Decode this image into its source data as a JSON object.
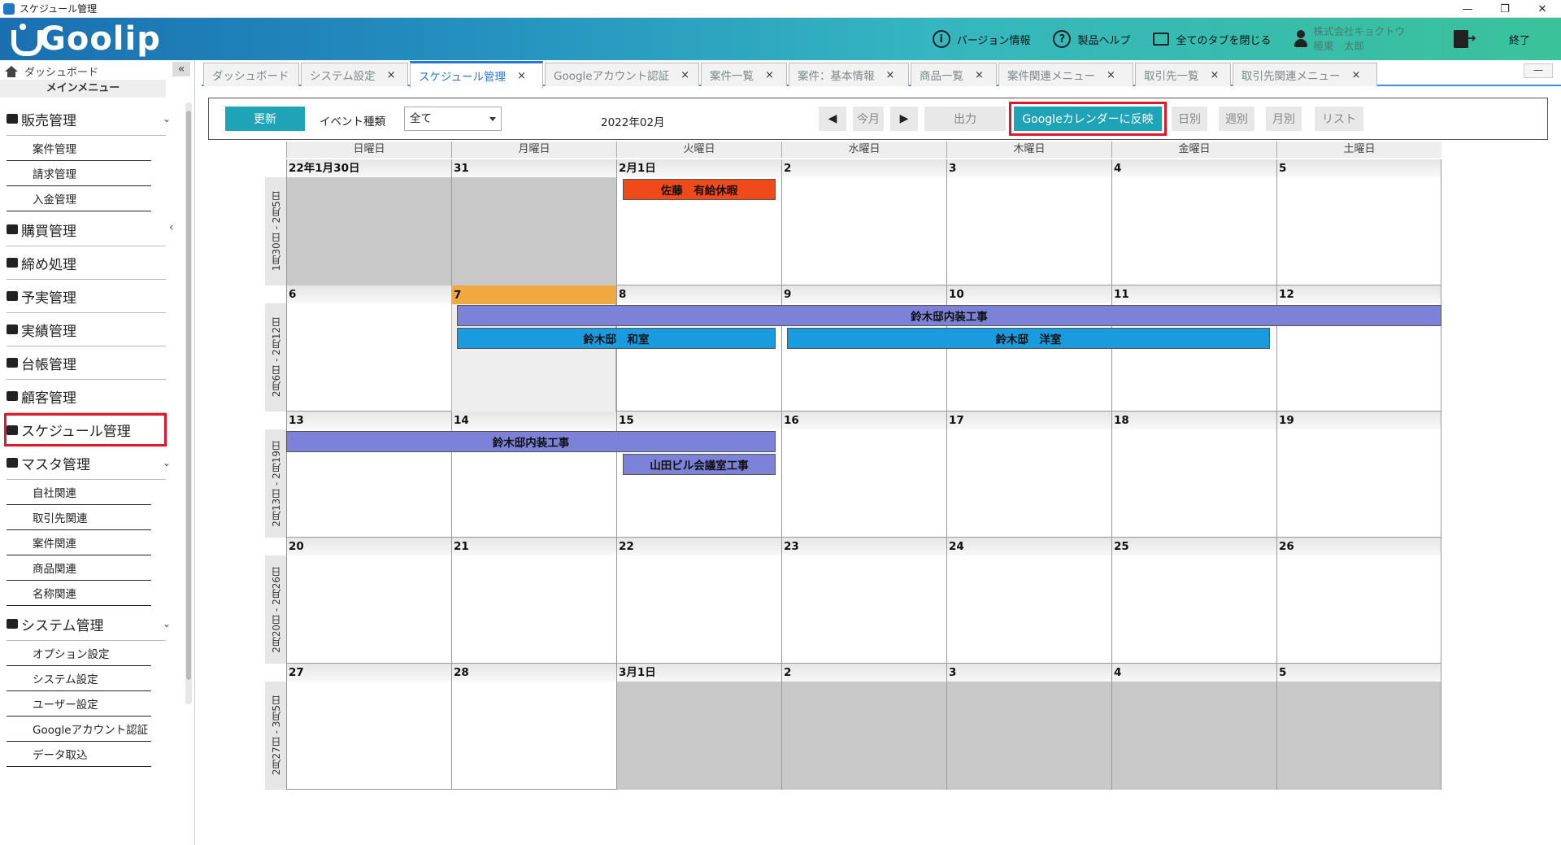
{
  "window": {
    "title": "スケジュール管理",
    "minimize": "—",
    "maximize": "❐",
    "close": "✕"
  },
  "header": {
    "logo": "Goolip",
    "version": "バージョン情報",
    "help": "製品ヘルプ",
    "close_tabs": "全てのタブを閉じる",
    "company": "株式会社キョクトウ",
    "user": "極東　太郎",
    "exit": "終了"
  },
  "sidebar": {
    "dashboard": "ダッシュボード",
    "collapse": "«",
    "main_menu": "メインメニュー",
    "side_chevron": "‹",
    "sales": {
      "label": "販売管理",
      "chev": "⌄",
      "items": [
        "案件管理",
        "請求管理",
        "入金管理"
      ]
    },
    "purchase": "購買管理",
    "closing": "締め処理",
    "budget": "予実管理",
    "results": "実績管理",
    "ledger": "台帳管理",
    "customer": "顧客管理",
    "schedule": "スケジュール管理",
    "master": {
      "label": "マスタ管理",
      "chev": "⌄",
      "items": [
        "自社関連",
        "取引先関連",
        "案件関連",
        "商品関連",
        "名称関連"
      ]
    },
    "system": {
      "label": "システム管理",
      "chev": "⌄",
      "items": [
        "オプション設定",
        "システム設定",
        "ユーザー設定",
        "Googleアカウント認証",
        "データ取込"
      ]
    }
  },
  "tabs": [
    {
      "label": "ダッシュボード",
      "close": ""
    },
    {
      "label": "システム設定",
      "close": "×"
    },
    {
      "label": "スケジュール管理",
      "close": "×"
    },
    {
      "label": "Googleアカウント認証",
      "close": "×"
    },
    {
      "label": "案件一覧",
      "close": "×"
    },
    {
      "label": "案件：基本情報",
      "close": "×"
    },
    {
      "label": "商品一覧",
      "close": "×"
    },
    {
      "label": "案件関連メニュー",
      "close": "×"
    },
    {
      "label": "取引先一覧",
      "close": "×"
    },
    {
      "label": "取引先関連メニュー",
      "close": "×"
    }
  ],
  "tab_minimize": "—",
  "toolbar": {
    "update": "更新",
    "event_type_label": "イベント種類",
    "event_type_value": "全て",
    "month": "2022年02月",
    "prev": "◀",
    "this_month": "今月",
    "next": "▶",
    "output": "出力",
    "google_calendar": "Googleカレンダーに反映",
    "daily": "日別",
    "weekly": "週別",
    "monthly": "月別",
    "list": "リスト"
  },
  "calendar": {
    "weekdays": [
      "日曜日",
      "月曜日",
      "火曜日",
      "水曜日",
      "木曜日",
      "金曜日",
      "土曜日"
    ],
    "weeks": [
      {
        "label": "1月30日 - 2月5日",
        "days": [
          "22年1月30日",
          "31",
          "2月1日",
          "2",
          "3",
          "4",
          "5"
        ]
      },
      {
        "label": "2月6日 - 2月12日",
        "days": [
          "6",
          "7",
          "8",
          "9",
          "10",
          "11",
          "12"
        ]
      },
      {
        "label": "2月13日 - 2月19日",
        "days": [
          "13",
          "14",
          "15",
          "16",
          "17",
          "18",
          "19"
        ]
      },
      {
        "label": "2月20日 - 2月26日",
        "days": [
          "20",
          "21",
          "22",
          "23",
          "24",
          "25",
          "26"
        ]
      },
      {
        "label": "2月27日 - 3月5日",
        "days": [
          "27",
          "28",
          "3月1日",
          "2",
          "3",
          "4",
          "5"
        ]
      }
    ],
    "events": {
      "sato": "佐藤　有給休暇",
      "suzuki_interior_1": "鈴木邸内装工事",
      "suzuki_washitsu": "鈴木邸　和室",
      "suzuki_youshitsu": "鈴木邸　洋室",
      "suzuki_interior_2": "鈴木邸内装工事",
      "yamada": "山田ビル会議室工事"
    }
  },
  "colors": {
    "accent": "#1ea3b7",
    "highlight": "#e1182c",
    "today": "#f0a840",
    "event_red": "#f04a1a",
    "event_purple": "#7b82d8",
    "event_blue": "#1a9be0"
  }
}
